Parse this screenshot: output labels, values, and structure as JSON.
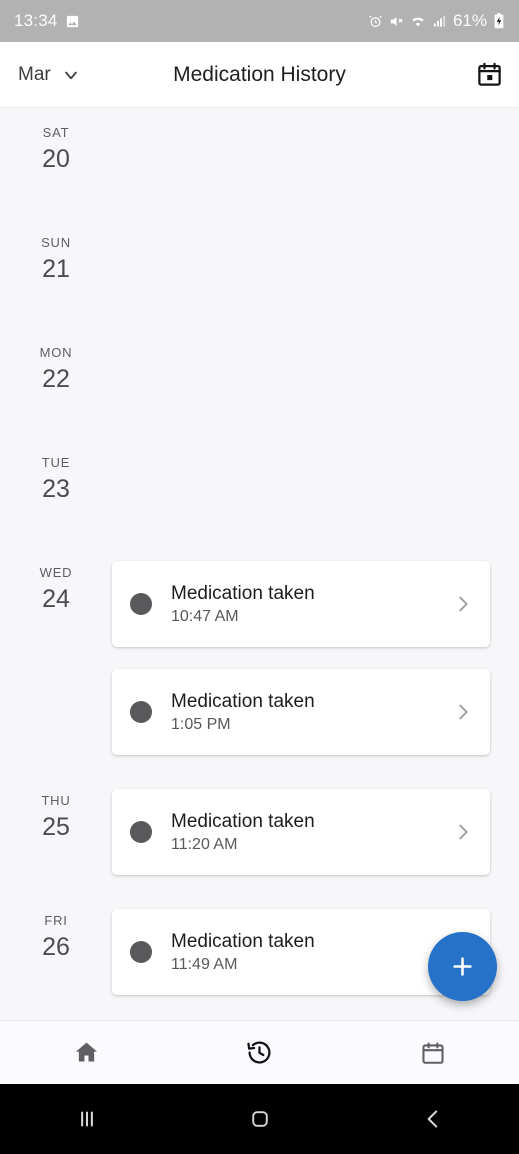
{
  "status_bar": {
    "time": "13:34",
    "battery_text": "61%",
    "icons": [
      "image-icon",
      "alarm-icon",
      "mute-icon",
      "wifi-icon",
      "cell-signal-icon",
      "battery-charging-icon"
    ],
    "background_color": "#b2b2b2"
  },
  "app_bar": {
    "month": "Mar",
    "title": "Medication History",
    "dropdown_icon": "chevron-down-icon",
    "calendar_action_icon": "calendar-icon"
  },
  "timeline": {
    "days": [
      {
        "weekday": "SAT",
        "date": "20",
        "entries": []
      },
      {
        "weekday": "SUN",
        "date": "21",
        "entries": []
      },
      {
        "weekday": "MON",
        "date": "22",
        "entries": []
      },
      {
        "weekday": "TUE",
        "date": "23",
        "entries": []
      },
      {
        "weekday": "WED",
        "date": "24",
        "entries": [
          {
            "title": "Medication taken",
            "time": "10:47 AM",
            "status_color": "#59595c",
            "chevron": "chevron-right-icon"
          },
          {
            "title": "Medication taken",
            "time": "1:05 PM",
            "status_color": "#59595c",
            "chevron": "chevron-right-icon"
          }
        ]
      },
      {
        "weekday": "THU",
        "date": "25",
        "entries": [
          {
            "title": "Medication taken",
            "time": "11:20 AM",
            "status_color": "#59595c",
            "chevron": "chevron-right-icon"
          }
        ]
      },
      {
        "weekday": "FRI",
        "date": "26",
        "entries": [
          {
            "title": "Medication taken",
            "time": "11:49 AM",
            "status_color": "#59595c",
            "chevron": "chevron-right-icon"
          }
        ]
      }
    ]
  },
  "fab": {
    "icon": "plus-icon",
    "color": "#2572c8"
  },
  "bottom_nav": {
    "items": [
      {
        "name": "home",
        "icon": "home-icon",
        "active": false
      },
      {
        "name": "history",
        "icon": "history-icon",
        "active": true
      },
      {
        "name": "calendar",
        "icon": "calendar-icon",
        "active": false
      }
    ]
  },
  "system_nav": {
    "items": [
      {
        "name": "recents",
        "icon": "recents-icon"
      },
      {
        "name": "home",
        "icon": "home-square-icon"
      },
      {
        "name": "back",
        "icon": "back-chevron-icon"
      }
    ]
  }
}
